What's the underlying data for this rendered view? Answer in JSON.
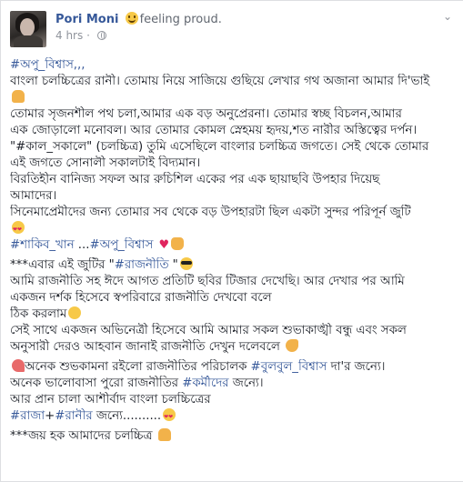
{
  "post": {
    "author": "Pori Moni",
    "feeling": "feeling proud.",
    "time": "4 hrs",
    "time_sep": "·",
    "menu_icon": "chevron-down-icon",
    "privacy_icon": "globe-icon"
  },
  "lines": {
    "l1": "#অপু_বিশ্বাস,,,",
    "l2": "বাংলা চলচ্চিত্রের রানী। তোমায় নিয়ে সাজিয়ে গুছিয়ে লেখার গথ অজানা আমার দি'ভাই",
    "l3": "তোমার সৃজনশীল পথ চলা,আমার এক বড় অনুপ্রেরনা। তোমার স্বচ্ছ বিচলন,আমার",
    "l4": "এক জোড়ালো মনোবল। আর তোমার কোমল স্নেহময় হৃদয়,শত নারীর অস্তিত্বের দর্পন।",
    "l5": "\"#কাল_সকালে\" (চলচ্চিত্র) তুমি এসেছিলে বাংলার চলচ্চিত্র জগতে। সেই থেকে তোমার",
    "l6": "এই জগতে সোনালী সকালটাই বিদ্যমান।",
    "l7": "বিরতিহীন বানিজ্য সফল আর রুচিশিল একের পর এক ছায়াছবি উপহার দিয়েছ",
    "l8": "আমাদের।",
    "l9": "সিনেমাপ্রেমীদের জন্য তোমার সব থেকে বড় উপহারটা ছিল একটা সুন্দর পরিপূর্ন জুটি",
    "l10a": "#শাকিব_খান",
    "l10b": " ...",
    "l10c": "#অপু_বিশ্বাস",
    "l11a": "***এবার এই জুটির \"",
    "l11b": "#রাজনীতি",
    "l11c": " \"",
    "l12": "আমি রাজনীতি সহ ঈদে আগত প্রতিটি ছবির টিজার দেখেছি। আর দেখার পর আমি",
    "l13": "একজন দর্শক হিসেবে স্বপরিবারে রাজনীতি দেখবো বলে",
    "l14": "ঠিক করলাম",
    "l15": "সেই সাথে একজন অভিনেত্রী হিসেবে আমি আমার সকল শুভাকাঙ্খী বন্ধু এবং সকল",
    "l16": "অনুসারী দেরও আহবান জানাই রাজনীতি দেখুন দলেবলে",
    "l17a": "অনেক শুভকামনা রইলো রাজনীতির পরিচালক ",
    "l17b": "#বুলবুল_বিশ্বাস",
    "l17c": " দা'র জন্যে।",
    "l18a": "অনেক ভালোবাসা পুরো রাজনীতির ",
    "l18b": "#কর্মীদের",
    "l18c": " জন্যে।",
    "l19": "আর প্রান চালা আশীর্বাদ বাংলা চলচ্চিত্রের",
    "l20a": "#রাজা",
    "l20b": "+",
    "l20c": "#রানীর",
    "l20d": " জন্যে..........",
    "l21": "***জয় হক আমাদের চলচ্চিত্র"
  },
  "icons": {
    "pray": "folded-hands-icon",
    "heart_eyes": "heart-eyes-icon",
    "heart": "heart-icon",
    "victory": "victory-hand-icon",
    "sunglasses": "sunglasses-icon",
    "smile": "smile-icon",
    "muscle": "flexed-biceps-icon",
    "flower": "bouquet-icon"
  },
  "colors": {
    "link": "#365899",
    "text": "#1d2129",
    "meta": "#90949c"
  }
}
